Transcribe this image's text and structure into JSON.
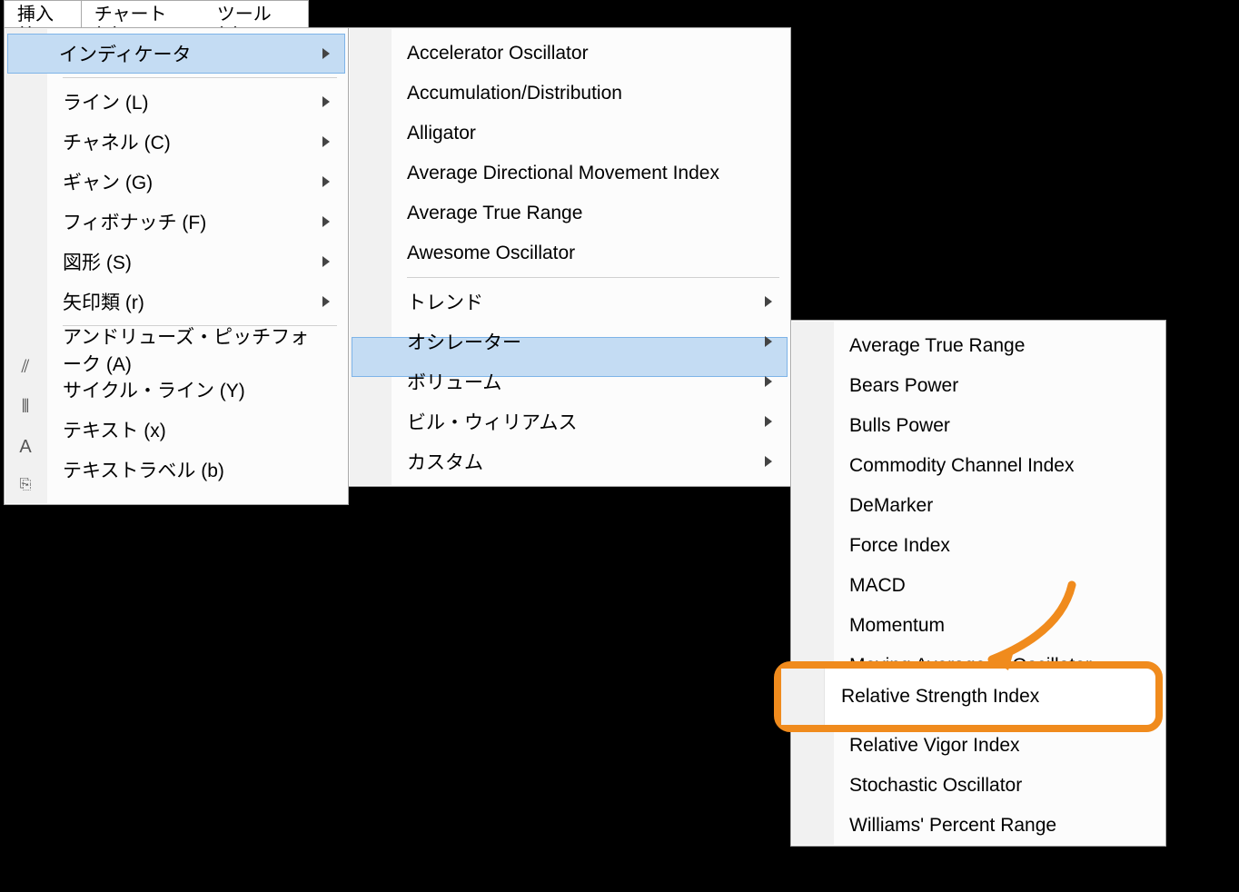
{
  "menubar": {
    "insert": "挿入(I)",
    "chart": "チャート (C)",
    "tool": "ツール (T)"
  },
  "menu1": {
    "indicators": "インディケータ",
    "line": "ライン (L)",
    "channel": "チャネル (C)",
    "gann": "ギャン (G)",
    "fibonacci": "フィボナッチ (F)",
    "shapes": "図形 (S)",
    "arrows": "矢印類 (r)",
    "andrews": "アンドリューズ・ピッチフォーク (A)",
    "cycle": "サイクル・ライン (Y)",
    "text": "テキスト (x)",
    "textlabel": "テキストラベル (b)"
  },
  "menu2": {
    "accel": "Accelerator Oscillator",
    "accdist": "Accumulation/Distribution",
    "alligator": "Alligator",
    "adx": "Average Directional Movement Index",
    "atr": "Average True Range",
    "awesome": "Awesome Oscillator",
    "trend": "トレンド",
    "oscillator": "オシレーター",
    "volume": "ボリューム",
    "billwilliams": "ビル・ウィリアムス",
    "custom": "カスタム"
  },
  "menu3": {
    "atr": "Average True Range",
    "bears": "Bears Power",
    "bulls": "Bulls Power",
    "cci": "Commodity Channel Index",
    "demarker": "DeMarker",
    "force": "Force Index",
    "macd": "MACD",
    "momentum": "Momentum",
    "mao": "Moving Average of Oscillator",
    "rsi": "Relative Strength Index",
    "rvi": "Relative Vigor Index",
    "stoch": "Stochastic Oscillator",
    "wpr": "Williams' Percent Range"
  },
  "annotation": {
    "highlight_label": "Relative Strength Index",
    "color": "#f08b1d"
  }
}
